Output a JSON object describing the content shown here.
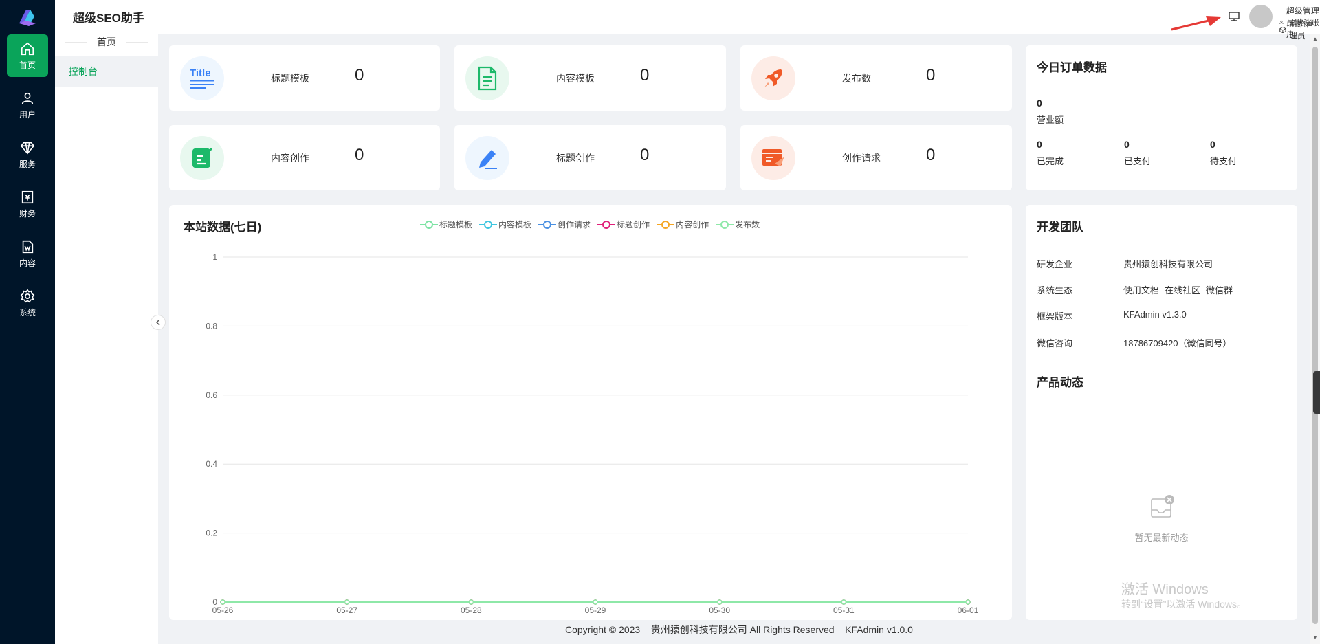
{
  "app": {
    "title": "超级SEO助手"
  },
  "rail": [
    {
      "label": "首页",
      "icon": "home-icon",
      "active": true
    },
    {
      "label": "用户",
      "icon": "user-icon",
      "active": false
    },
    {
      "label": "服务",
      "icon": "diamond-icon",
      "active": false
    },
    {
      "label": "财务",
      "icon": "finance-icon",
      "active": false
    },
    {
      "label": "内容",
      "icon": "document-icon",
      "active": false
    },
    {
      "label": "系统",
      "icon": "gear-icon",
      "active": false
    }
  ],
  "submenu": {
    "title": "首页",
    "item": "控制台"
  },
  "user": {
    "name": "超级管理员默认账户",
    "role": "系统管理员"
  },
  "stats": [
    {
      "label": "标题模板",
      "value": "0",
      "icon": "title-template-icon",
      "bg": "#eef6fe"
    },
    {
      "label": "内容模板",
      "value": "0",
      "icon": "content-template-icon",
      "bg": "#e8f8ef"
    },
    {
      "label": "发布数",
      "value": "0",
      "icon": "rocket-icon",
      "bg": "#fdece6"
    },
    {
      "label": "内容创作",
      "value": "0",
      "icon": "content-create-icon",
      "bg": "#e8f8ef"
    },
    {
      "label": "标题创作",
      "value": "0",
      "icon": "pen-icon",
      "bg": "#eef6fe"
    },
    {
      "label": "创作请求",
      "value": "0",
      "icon": "request-icon",
      "bg": "#fdece6"
    }
  ],
  "orders": {
    "title": "今日订单数据",
    "revenue": {
      "value": "0",
      "label": "营业额"
    },
    "completed": {
      "value": "0",
      "label": "已完成"
    },
    "paid": {
      "value": "0",
      "label": "已支付"
    },
    "pending": {
      "value": "0",
      "label": "待支付"
    }
  },
  "team": {
    "title": "开发团队",
    "company_key": "研发企业",
    "company_val": "贵州猿创科技有限公司",
    "eco_key": "系统生态",
    "eco_links": [
      "使用文档",
      "在线社区",
      "微信群"
    ],
    "version_key": "框架版本",
    "version_val": "KFAdmin v1.3.0",
    "wechat_key": "微信咨询",
    "wechat_val": "18786709420（微信同号）"
  },
  "news": {
    "title": "产品动态",
    "empty": "暂无最新动态"
  },
  "chart_data": {
    "type": "line",
    "title": "本站数据(七日)",
    "x": [
      "05-26",
      "05-27",
      "05-28",
      "05-29",
      "05-30",
      "05-31",
      "06-01"
    ],
    "ylim": [
      0,
      1
    ],
    "yticks": [
      "0",
      "0.2",
      "0.4",
      "0.6",
      "0.8",
      "1"
    ],
    "grid": true,
    "legend_position": "top",
    "series": [
      {
        "name": "标题模板",
        "color": "#7de3a4",
        "values": [
          0,
          0,
          0,
          0,
          0,
          0,
          0
        ]
      },
      {
        "name": "内容模板",
        "color": "#3fc6e0",
        "values": [
          0,
          0,
          0,
          0,
          0,
          0,
          0
        ]
      },
      {
        "name": "创作请求",
        "color": "#4a90e2",
        "values": [
          0,
          0,
          0,
          0,
          0,
          0,
          0
        ]
      },
      {
        "name": "标题创作",
        "color": "#e0207a",
        "values": [
          0,
          0,
          0,
          0,
          0,
          0,
          0
        ]
      },
      {
        "name": "内容创作",
        "color": "#f5a623",
        "values": [
          0,
          0,
          0,
          0,
          0,
          0,
          0
        ]
      },
      {
        "name": "发布数",
        "color": "#8ee8a8",
        "values": [
          0,
          0,
          0,
          0,
          0,
          0,
          0
        ]
      }
    ]
  },
  "watermark": {
    "line1": "激活 Windows",
    "line2": "转到“设置”以激活 Windows。"
  },
  "footer": "Copyright © 2023    贵州猿创科技有限公司 All Rights Reserved    KFAdmin v1.0.0"
}
